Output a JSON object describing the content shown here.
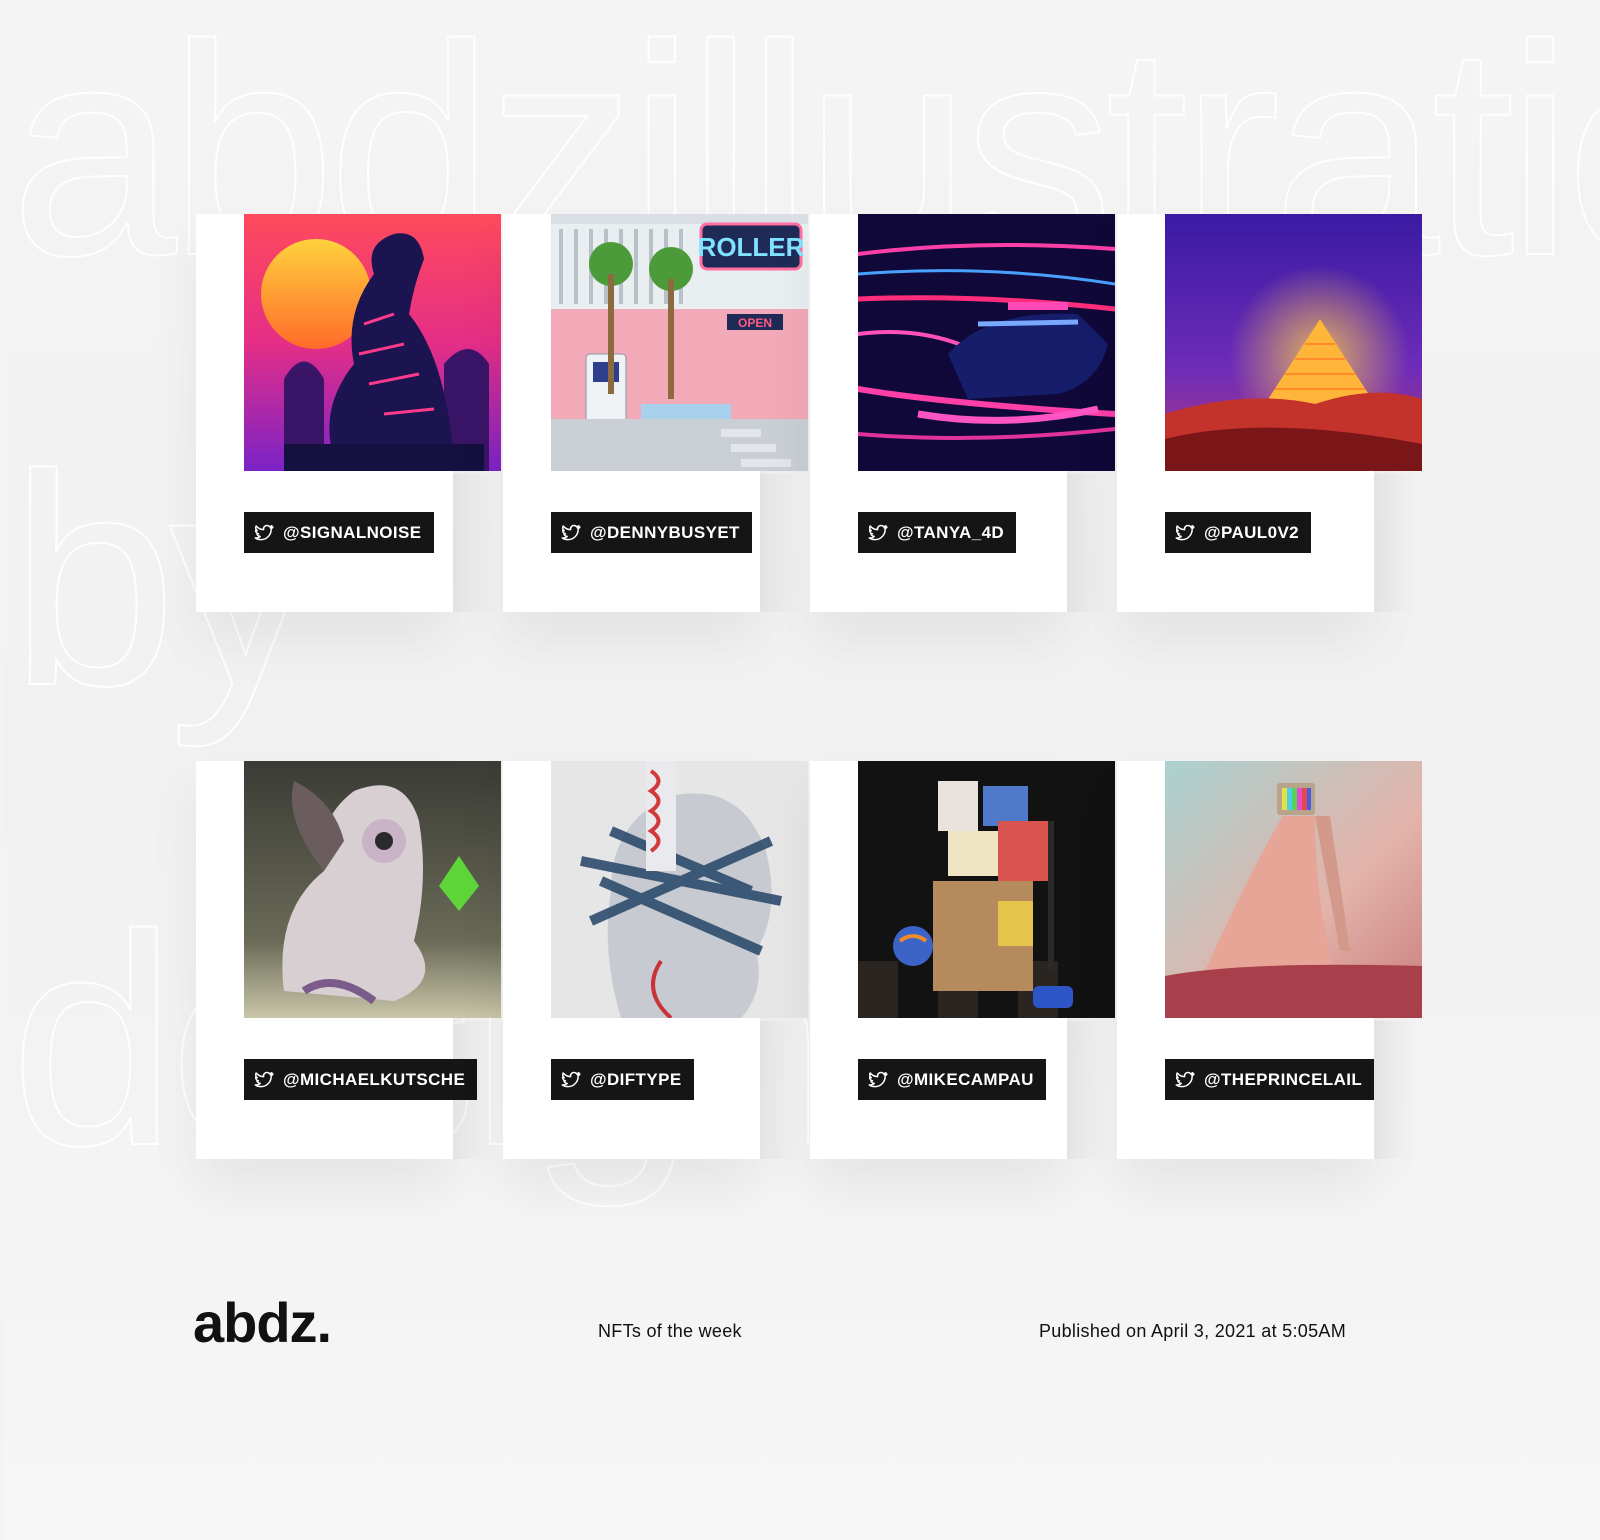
{
  "brand": {
    "logo": "abdz."
  },
  "footer": {
    "section": "NFTs of the week",
    "published": "Published on April 3, 2021 at 5:05AM"
  },
  "watermark": [
    "abdzillustrations",
    "by",
    "design"
  ],
  "artworks": [
    {
      "handle": "@SIGNALNOISE",
      "subject": "neon tiger at sunset",
      "colors": [
        "#f1365f",
        "#6b1fb0",
        "#ffb02e"
      ]
    },
    {
      "handle": "@DENNYBUSYET",
      "subject": "pastel roller diner",
      "colors": [
        "#f3a7b4",
        "#cfd7db",
        "#4fb6c7"
      ]
    },
    {
      "handle": "@TANYA_4D",
      "subject": "neon car light trails",
      "colors": [
        "#1b0b5e",
        "#ff3fa8",
        "#3f6bff"
      ]
    },
    {
      "handle": "@PAUL0V2",
      "subject": "desert pyramid",
      "colors": [
        "#4b1a9c",
        "#c9312c",
        "#ffb53b"
      ]
    },
    {
      "handle": "@MICHAELKUTSCHE",
      "subject": "surreal creature",
      "colors": [
        "#4b4b42",
        "#d9cfcf",
        "#58d23a"
      ]
    },
    {
      "handle": "@DIFTYPE",
      "subject": "taped head portrait",
      "colors": [
        "#e4e4e4",
        "#2f4d6c",
        "#d23a3a"
      ]
    },
    {
      "handle": "@MIKECAMPAU",
      "subject": "stack of retro toys",
      "colors": [
        "#141414",
        "#b08356",
        "#3c63c7"
      ]
    },
    {
      "handle": "@THEPRINCELAIL",
      "subject": "figure with tv head",
      "colors": [
        "#9bc9c8",
        "#e3a69b",
        "#a8404b"
      ]
    }
  ]
}
